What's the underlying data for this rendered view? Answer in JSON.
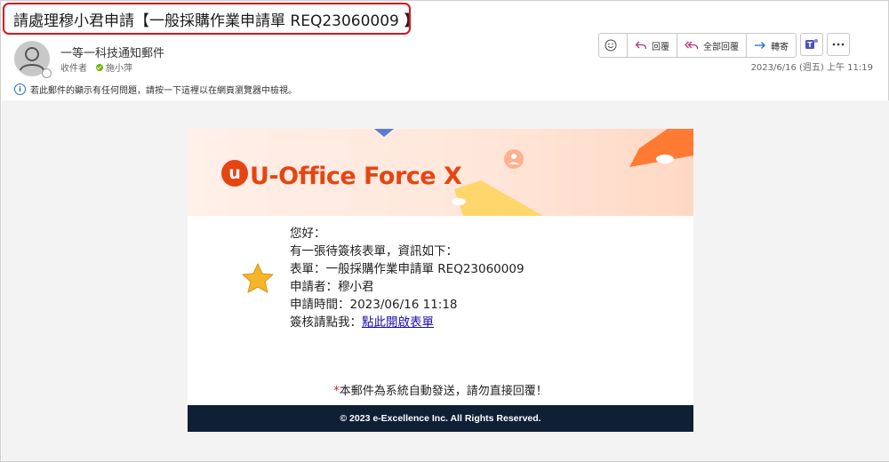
{
  "subject": "請處理穆小君申請【一般採購作業申請單 REQ23060009 】",
  "header": {
    "sender_name": "一等一科技通知郵件",
    "to_label": "收件者",
    "recipient": "施小萍",
    "date": "2023/6/16 (週五) 上午 11:19",
    "info_message": "若此郵件的顯示有任何問題，請按一下這裡以在網頁瀏覽器中檢視。"
  },
  "toolbar": {
    "reply_label": "回覆",
    "reply_all_label": "全部回覆",
    "forward_label": "轉寄",
    "icons": [
      "emoji-icon",
      "reply-icon",
      "reply-all-icon",
      "forward-icon",
      "teams-icon",
      "more-icon"
    ]
  },
  "email": {
    "logo": "U-Office Force X",
    "greeting": "您好：",
    "intro": "有一張待簽核表單，資訊如下：",
    "form_line": "表單：一般採購作業申請單 REQ23060009",
    "applicant_line": "申請者：穆小君",
    "time_line": "申請時間：2023/06/16 11:18",
    "sign_prefix": "簽核請點我：",
    "sign_link": "點此開啟表單",
    "notice_mark": "*",
    "notice": "本郵件為系統自動發送，請勿直接回覆！",
    "copyright": "© 2023 e-Excellence Inc. All Rights Reserved."
  },
  "colors": {
    "highlight_border": "#d9141b",
    "brand_orange": "#e64512",
    "footer_bg": "#0f2036",
    "link": "#1a0dab"
  }
}
